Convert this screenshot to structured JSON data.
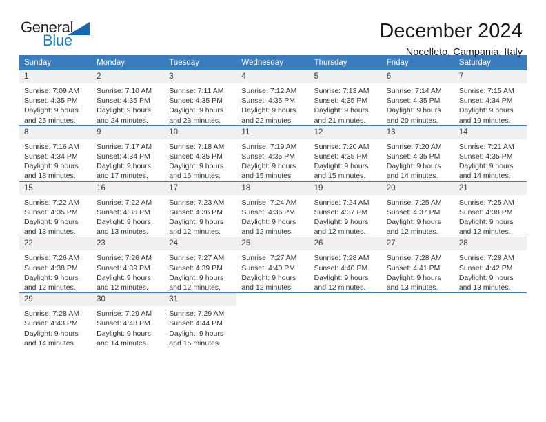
{
  "brand": {
    "name_part1": "General",
    "name_part2": "Blue",
    "triangle_color": "#1668b0",
    "blue_color": "#1a7dc4"
  },
  "header": {
    "title": "December 2024",
    "subtitle": "Nocelleto, Campania, Italy"
  },
  "theme": {
    "header_bg": "#3a7dbf",
    "daynum_bg": "#f0f0f0",
    "text": "#333333"
  },
  "weekday_headers": [
    "Sunday",
    "Monday",
    "Tuesday",
    "Wednesday",
    "Thursday",
    "Friday",
    "Saturday"
  ],
  "weeks": [
    [
      {
        "day": "1",
        "sunrise": "Sunrise: 7:09 AM",
        "sunset": "Sunset: 4:35 PM",
        "daylight_line1": "Daylight: 9 hours",
        "daylight_line2": "and 25 minutes."
      },
      {
        "day": "2",
        "sunrise": "Sunrise: 7:10 AM",
        "sunset": "Sunset: 4:35 PM",
        "daylight_line1": "Daylight: 9 hours",
        "daylight_line2": "and 24 minutes."
      },
      {
        "day": "3",
        "sunrise": "Sunrise: 7:11 AM",
        "sunset": "Sunset: 4:35 PM",
        "daylight_line1": "Daylight: 9 hours",
        "daylight_line2": "and 23 minutes."
      },
      {
        "day": "4",
        "sunrise": "Sunrise: 7:12 AM",
        "sunset": "Sunset: 4:35 PM",
        "daylight_line1": "Daylight: 9 hours",
        "daylight_line2": "and 22 minutes."
      },
      {
        "day": "5",
        "sunrise": "Sunrise: 7:13 AM",
        "sunset": "Sunset: 4:35 PM",
        "daylight_line1": "Daylight: 9 hours",
        "daylight_line2": "and 21 minutes."
      },
      {
        "day": "6",
        "sunrise": "Sunrise: 7:14 AM",
        "sunset": "Sunset: 4:35 PM",
        "daylight_line1": "Daylight: 9 hours",
        "daylight_line2": "and 20 minutes."
      },
      {
        "day": "7",
        "sunrise": "Sunrise: 7:15 AM",
        "sunset": "Sunset: 4:34 PM",
        "daylight_line1": "Daylight: 9 hours",
        "daylight_line2": "and 19 minutes."
      }
    ],
    [
      {
        "day": "8",
        "sunrise": "Sunrise: 7:16 AM",
        "sunset": "Sunset: 4:34 PM",
        "daylight_line1": "Daylight: 9 hours",
        "daylight_line2": "and 18 minutes."
      },
      {
        "day": "9",
        "sunrise": "Sunrise: 7:17 AM",
        "sunset": "Sunset: 4:34 PM",
        "daylight_line1": "Daylight: 9 hours",
        "daylight_line2": "and 17 minutes."
      },
      {
        "day": "10",
        "sunrise": "Sunrise: 7:18 AM",
        "sunset": "Sunset: 4:35 PM",
        "daylight_line1": "Daylight: 9 hours",
        "daylight_line2": "and 16 minutes."
      },
      {
        "day": "11",
        "sunrise": "Sunrise: 7:19 AM",
        "sunset": "Sunset: 4:35 PM",
        "daylight_line1": "Daylight: 9 hours",
        "daylight_line2": "and 15 minutes."
      },
      {
        "day": "12",
        "sunrise": "Sunrise: 7:20 AM",
        "sunset": "Sunset: 4:35 PM",
        "daylight_line1": "Daylight: 9 hours",
        "daylight_line2": "and 15 minutes."
      },
      {
        "day": "13",
        "sunrise": "Sunrise: 7:20 AM",
        "sunset": "Sunset: 4:35 PM",
        "daylight_line1": "Daylight: 9 hours",
        "daylight_line2": "and 14 minutes."
      },
      {
        "day": "14",
        "sunrise": "Sunrise: 7:21 AM",
        "sunset": "Sunset: 4:35 PM",
        "daylight_line1": "Daylight: 9 hours",
        "daylight_line2": "and 14 minutes."
      }
    ],
    [
      {
        "day": "15",
        "sunrise": "Sunrise: 7:22 AM",
        "sunset": "Sunset: 4:35 PM",
        "daylight_line1": "Daylight: 9 hours",
        "daylight_line2": "and 13 minutes."
      },
      {
        "day": "16",
        "sunrise": "Sunrise: 7:22 AM",
        "sunset": "Sunset: 4:36 PM",
        "daylight_line1": "Daylight: 9 hours",
        "daylight_line2": "and 13 minutes."
      },
      {
        "day": "17",
        "sunrise": "Sunrise: 7:23 AM",
        "sunset": "Sunset: 4:36 PM",
        "daylight_line1": "Daylight: 9 hours",
        "daylight_line2": "and 12 minutes."
      },
      {
        "day": "18",
        "sunrise": "Sunrise: 7:24 AM",
        "sunset": "Sunset: 4:36 PM",
        "daylight_line1": "Daylight: 9 hours",
        "daylight_line2": "and 12 minutes."
      },
      {
        "day": "19",
        "sunrise": "Sunrise: 7:24 AM",
        "sunset": "Sunset: 4:37 PM",
        "daylight_line1": "Daylight: 9 hours",
        "daylight_line2": "and 12 minutes."
      },
      {
        "day": "20",
        "sunrise": "Sunrise: 7:25 AM",
        "sunset": "Sunset: 4:37 PM",
        "daylight_line1": "Daylight: 9 hours",
        "daylight_line2": "and 12 minutes."
      },
      {
        "day": "21",
        "sunrise": "Sunrise: 7:25 AM",
        "sunset": "Sunset: 4:38 PM",
        "daylight_line1": "Daylight: 9 hours",
        "daylight_line2": "and 12 minutes."
      }
    ],
    [
      {
        "day": "22",
        "sunrise": "Sunrise: 7:26 AM",
        "sunset": "Sunset: 4:38 PM",
        "daylight_line1": "Daylight: 9 hours",
        "daylight_line2": "and 12 minutes."
      },
      {
        "day": "23",
        "sunrise": "Sunrise: 7:26 AM",
        "sunset": "Sunset: 4:39 PM",
        "daylight_line1": "Daylight: 9 hours",
        "daylight_line2": "and 12 minutes."
      },
      {
        "day": "24",
        "sunrise": "Sunrise: 7:27 AM",
        "sunset": "Sunset: 4:39 PM",
        "daylight_line1": "Daylight: 9 hours",
        "daylight_line2": "and 12 minutes."
      },
      {
        "day": "25",
        "sunrise": "Sunrise: 7:27 AM",
        "sunset": "Sunset: 4:40 PM",
        "daylight_line1": "Daylight: 9 hours",
        "daylight_line2": "and 12 minutes."
      },
      {
        "day": "26",
        "sunrise": "Sunrise: 7:28 AM",
        "sunset": "Sunset: 4:40 PM",
        "daylight_line1": "Daylight: 9 hours",
        "daylight_line2": "and 12 minutes."
      },
      {
        "day": "27",
        "sunrise": "Sunrise: 7:28 AM",
        "sunset": "Sunset: 4:41 PM",
        "daylight_line1": "Daylight: 9 hours",
        "daylight_line2": "and 13 minutes."
      },
      {
        "day": "28",
        "sunrise": "Sunrise: 7:28 AM",
        "sunset": "Sunset: 4:42 PM",
        "daylight_line1": "Daylight: 9 hours",
        "daylight_line2": "and 13 minutes."
      }
    ],
    [
      {
        "day": "29",
        "sunrise": "Sunrise: 7:28 AM",
        "sunset": "Sunset: 4:43 PM",
        "daylight_line1": "Daylight: 9 hours",
        "daylight_line2": "and 14 minutes."
      },
      {
        "day": "30",
        "sunrise": "Sunrise: 7:29 AM",
        "sunset": "Sunset: 4:43 PM",
        "daylight_line1": "Daylight: 9 hours",
        "daylight_line2": "and 14 minutes."
      },
      {
        "day": "31",
        "sunrise": "Sunrise: 7:29 AM",
        "sunset": "Sunset: 4:44 PM",
        "daylight_line1": "Daylight: 9 hours",
        "daylight_line2": "and 15 minutes."
      },
      {
        "day": "",
        "sunrise": "",
        "sunset": "",
        "daylight_line1": "",
        "daylight_line2": ""
      },
      {
        "day": "",
        "sunrise": "",
        "sunset": "",
        "daylight_line1": "",
        "daylight_line2": ""
      },
      {
        "day": "",
        "sunrise": "",
        "sunset": "",
        "daylight_line1": "",
        "daylight_line2": ""
      },
      {
        "day": "",
        "sunrise": "",
        "sunset": "",
        "daylight_line1": "",
        "daylight_line2": ""
      }
    ]
  ]
}
